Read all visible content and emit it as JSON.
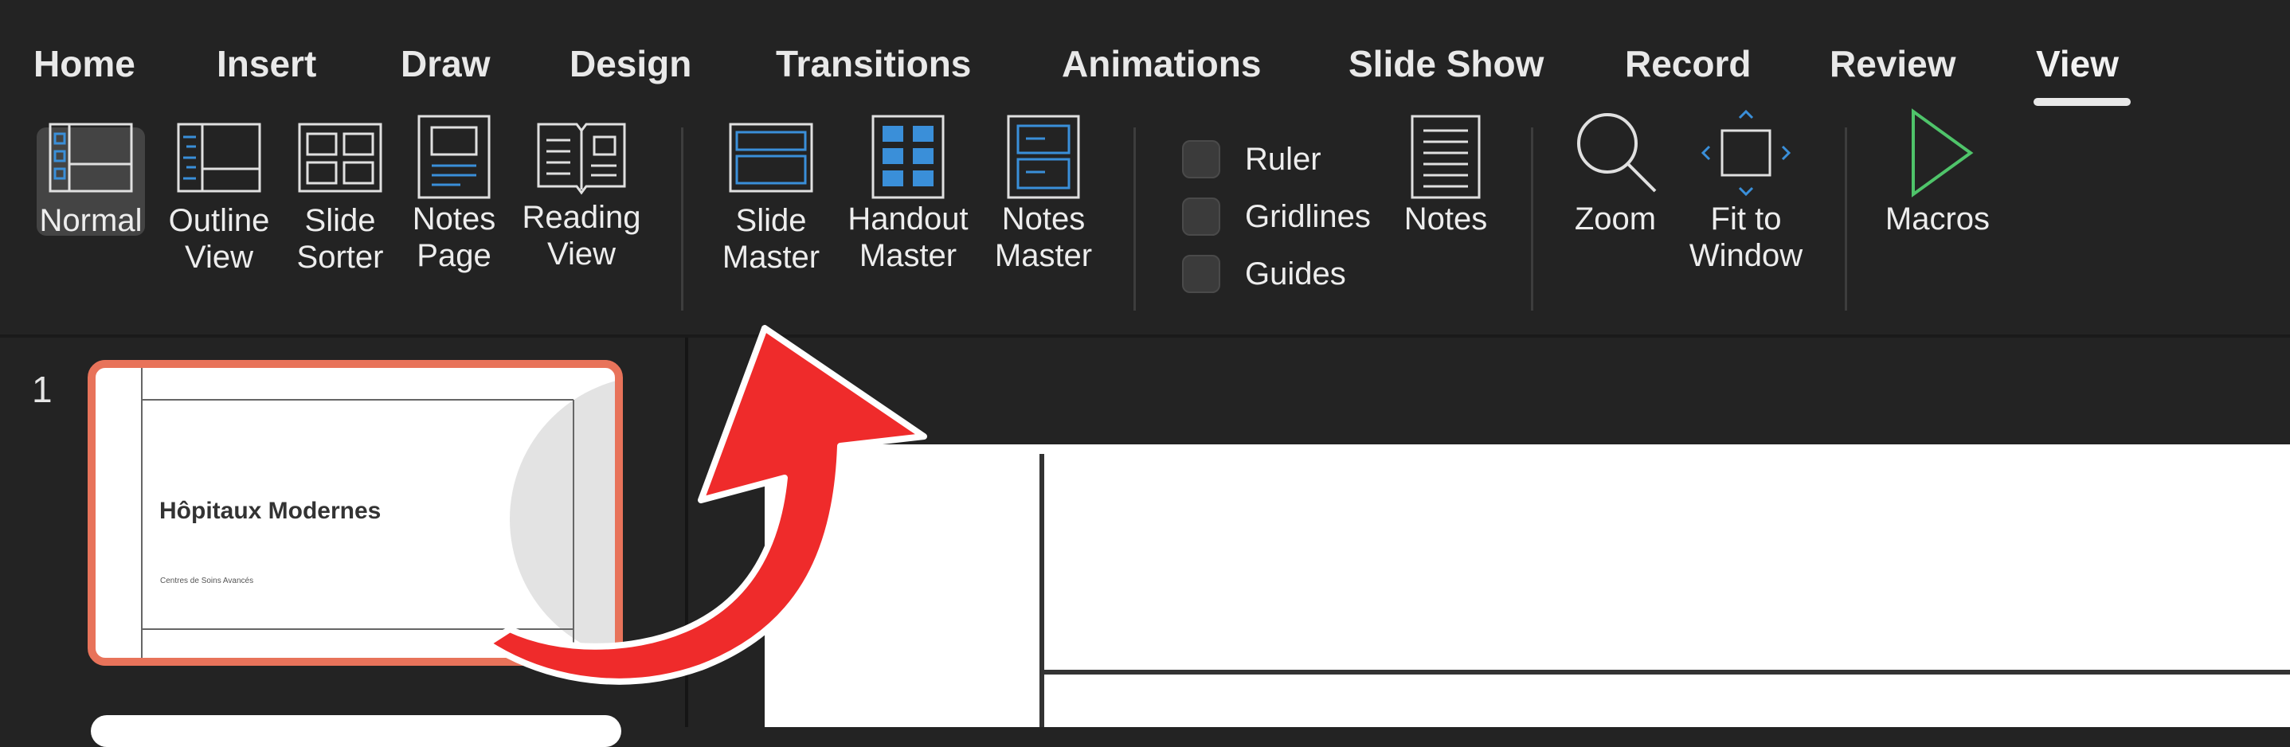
{
  "tabs": [
    {
      "label": "Home",
      "active": false
    },
    {
      "label": "Insert",
      "active": false
    },
    {
      "label": "Draw",
      "active": false
    },
    {
      "label": "Design",
      "active": false
    },
    {
      "label": "Transitions",
      "active": false
    },
    {
      "label": "Animations",
      "active": false
    },
    {
      "label": "Slide Show",
      "active": false
    },
    {
      "label": "Record",
      "active": false
    },
    {
      "label": "Review",
      "active": false
    },
    {
      "label": "View",
      "active": true
    }
  ],
  "ribbon": {
    "normal": {
      "line1": "Normal",
      "line2": "",
      "selected": true
    },
    "outline_view": {
      "line1": "Outline",
      "line2": "View"
    },
    "slide_sorter": {
      "line1": "Slide",
      "line2": "Sorter"
    },
    "notes_page": {
      "line1": "Notes",
      "line2": "Page"
    },
    "reading_view": {
      "line1": "Reading",
      "line2": "View"
    },
    "slide_master": {
      "line1": "Slide",
      "line2": "Master"
    },
    "handout_master": {
      "line1": "Handout",
      "line2": "Master"
    },
    "notes_master": {
      "line1": "Notes",
      "line2": "Master"
    },
    "ruler": {
      "label": "Ruler",
      "checked": false
    },
    "gridlines": {
      "label": "Gridlines",
      "checked": false
    },
    "guides": {
      "label": "Guides",
      "checked": false
    },
    "notes": {
      "line1": "Notes"
    },
    "zoom": {
      "line1": "Zoom"
    },
    "fit_to_window": {
      "line1": "Fit to",
      "line2": "Window"
    },
    "macros": {
      "line1": "Macros"
    }
  },
  "thumbnails": [
    {
      "number": "1",
      "title": "Hôpitaux Modernes",
      "subtitle": "Centres de Soins Avancés",
      "selected": true
    }
  ],
  "colors": {
    "accent_blue": "#3a8fd9",
    "macro_green": "#4fc46a",
    "selection_border": "#e8735a",
    "arrow_red": "#ef2b2b"
  },
  "icons": {
    "normal": "normal-view-icon",
    "outline": "outline-view-icon",
    "sorter": "slide-sorter-icon",
    "notes_page": "notes-page-icon",
    "reading": "reading-view-icon",
    "slide_master": "slide-master-icon",
    "handout_master": "handout-master-icon",
    "notes_master": "notes-master-icon",
    "notes": "notes-icon",
    "zoom": "zoom-icon",
    "fit": "fit-to-window-icon",
    "macros": "macros-play-icon",
    "annotation": "curved-arrow-icon"
  }
}
